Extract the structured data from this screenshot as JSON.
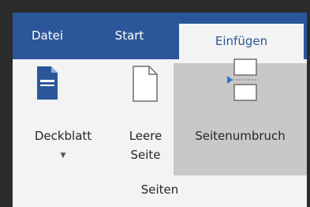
{
  "tabs": {
    "datei": "Datei",
    "start": "Start",
    "einfuegen": "Einfügen"
  },
  "ribbon": {
    "deckblatt": {
      "label": "Deckblatt",
      "icon": "cover-page-icon"
    },
    "leere_seite": {
      "line1": "Leere",
      "line2": "Seite",
      "icon": "blank-page-icon"
    },
    "seitenumbruch": {
      "label": "Seitenumbruch",
      "icon": "page-break-icon"
    },
    "group_label": "Seiten"
  },
  "colors": {
    "accent": "#2b579a",
    "ribbon_bg": "#f3f3f3",
    "hover": "#c8c8c8"
  }
}
